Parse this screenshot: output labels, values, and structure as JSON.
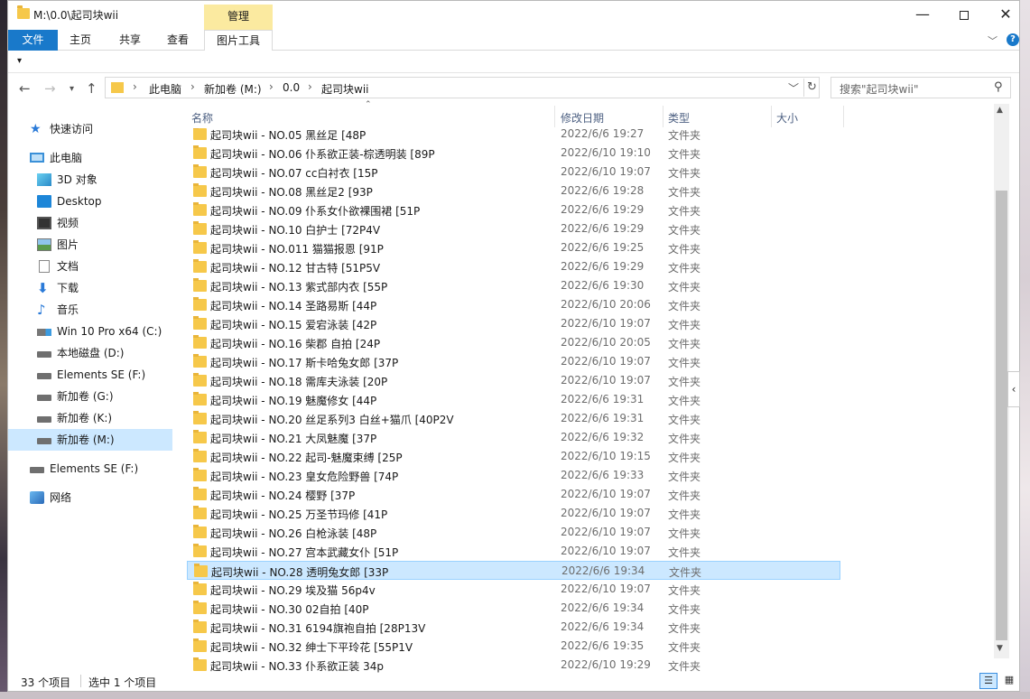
{
  "window": {
    "title": "M:\\0.0\\起司块wii",
    "manage_tab": "管理",
    "controls": {
      "minimize": "—",
      "maximize": "",
      "close": "✕"
    }
  },
  "ribbon": {
    "tabs": [
      "文件",
      "主页",
      "共享",
      "查看",
      "图片工具"
    ],
    "help": "?"
  },
  "address": {
    "crumbs": [
      "此电脑",
      "新加卷 (M:)",
      "0.0",
      "起司块wii"
    ]
  },
  "search": {
    "placeholder": "搜索\"起司块wii\""
  },
  "nav": {
    "quick_access": "快速访问",
    "this_pc": "此电脑",
    "items": [
      {
        "label": "3D 对象",
        "icon": "3d-objects-icon"
      },
      {
        "label": "Desktop",
        "icon": "desktop-icon"
      },
      {
        "label": "视频",
        "icon": "video-icon"
      },
      {
        "label": "图片",
        "icon": "pictures-icon"
      },
      {
        "label": "文档",
        "icon": "documents-icon"
      },
      {
        "label": "下载",
        "icon": "download-icon"
      },
      {
        "label": "音乐",
        "icon": "music-icon"
      },
      {
        "label": "Win 10 Pro x64 (C:)",
        "icon": "windows-drive-icon"
      },
      {
        "label": "本地磁盘 (D:)",
        "icon": "drive-icon"
      },
      {
        "label": "Elements SE (F:)",
        "icon": "drive-icon"
      },
      {
        "label": "新加卷 (G:)",
        "icon": "drive-icon"
      },
      {
        "label": "新加卷 (K:)",
        "icon": "drive-icon"
      },
      {
        "label": "新加卷 (M:)",
        "icon": "drive-icon"
      }
    ],
    "elements_se": "Elements SE (F:)",
    "network": "网络"
  },
  "columns": {
    "name": "名称",
    "date": "修改日期",
    "type": "类型",
    "size": "大小"
  },
  "files": [
    {
      "name": "起司块wii - NO.05 黑丝足 [48P",
      "date": "2022/6/6 19:27",
      "type": "文件夹"
    },
    {
      "name": "起司块wii - NO.06 仆系欲正装-棕透明装 [89P",
      "date": "2022/6/10 19:10",
      "type": "文件夹"
    },
    {
      "name": "起司块wii - NO.07 cc白衬衣 [15P",
      "date": "2022/6/10 19:07",
      "type": "文件夹"
    },
    {
      "name": "起司块wii - NO.08 黑丝足2 [93P",
      "date": "2022/6/6 19:28",
      "type": "文件夹"
    },
    {
      "name": "起司块wii - NO.09 仆系女仆欲裸围裙 [51P",
      "date": "2022/6/6 19:29",
      "type": "文件夹"
    },
    {
      "name": "起司块wii - NO.10 白护士 [72P4V",
      "date": "2022/6/6 19:29",
      "type": "文件夹"
    },
    {
      "name": "起司块wii - NO.011 猫猫报恩 [91P",
      "date": "2022/6/6 19:25",
      "type": "文件夹"
    },
    {
      "name": "起司块wii - NO.12 甘古特 [51P5V",
      "date": "2022/6/6 19:29",
      "type": "文件夹"
    },
    {
      "name": "起司块wii - NO.13 紫式部内衣 [55P",
      "date": "2022/6/6 19:30",
      "type": "文件夹"
    },
    {
      "name": "起司块wii - NO.14 圣路易斯 [44P",
      "date": "2022/6/10 20:06",
      "type": "文件夹"
    },
    {
      "name": "起司块wii - NO.15 爱宕泳装 [42P",
      "date": "2022/6/10 19:07",
      "type": "文件夹"
    },
    {
      "name": "起司块wii - NO.16 柴郡 自拍 [24P",
      "date": "2022/6/10 20:05",
      "type": "文件夹"
    },
    {
      "name": "起司块wii - NO.17 斯卡哈兔女郎 [37P",
      "date": "2022/6/10 19:07",
      "type": "文件夹"
    },
    {
      "name": "起司块wii - NO.18 需库夫泳装 [20P",
      "date": "2022/6/10 19:07",
      "type": "文件夹"
    },
    {
      "name": "起司块wii - NO.19 魅魔修女 [44P",
      "date": "2022/6/6 19:31",
      "type": "文件夹"
    },
    {
      "name": "起司块wii - NO.20 丝足系列3 白丝+猫爪 [40P2V",
      "date": "2022/6/6 19:31",
      "type": "文件夹"
    },
    {
      "name": "起司块wii - NO.21 大凤魅魔 [37P",
      "date": "2022/6/6 19:32",
      "type": "文件夹"
    },
    {
      "name": "起司块wii - NO.22 起司-魅魔束缚 [25P",
      "date": "2022/6/10 19:15",
      "type": "文件夹"
    },
    {
      "name": "起司块wii - NO.23 皇女危险野兽 [74P",
      "date": "2022/6/6 19:33",
      "type": "文件夹"
    },
    {
      "name": "起司块wii - NO.24 樱野 [37P",
      "date": "2022/6/10 19:07",
      "type": "文件夹"
    },
    {
      "name": "起司块wii - NO.25 万圣节玛修 [41P",
      "date": "2022/6/10 19:07",
      "type": "文件夹"
    },
    {
      "name": "起司块wii - NO.26 白枪泳装 [48P",
      "date": "2022/6/10 19:07",
      "type": "文件夹"
    },
    {
      "name": "起司块wii - NO.27 宫本武藏女仆 [51P",
      "date": "2022/6/10 19:07",
      "type": "文件夹"
    },
    {
      "name": "起司块wii - NO.28 透明兔女郎 [33P",
      "date": "2022/6/6 19:34",
      "type": "文件夹",
      "selected": true
    },
    {
      "name": "起司块wii - NO.29 埃及猫 56p4v",
      "date": "2022/6/10 19:07",
      "type": "文件夹"
    },
    {
      "name": "起司块wii - NO.30 02自拍 [40P",
      "date": "2022/6/6 19:34",
      "type": "文件夹"
    },
    {
      "name": "起司块wii - NO.31 6194旗袍自拍 [28P13V",
      "date": "2022/6/6 19:34",
      "type": "文件夹"
    },
    {
      "name": "起司块wii - NO.32 绅士下平玲花 [55P1V",
      "date": "2022/6/6 19:35",
      "type": "文件夹"
    },
    {
      "name": "起司块wii - NO.33 仆系欲正装 34p",
      "date": "2022/6/10 19:29",
      "type": "文件夹"
    }
  ],
  "status": {
    "count": "33 个项目",
    "selection": "选中 1 个项目"
  }
}
